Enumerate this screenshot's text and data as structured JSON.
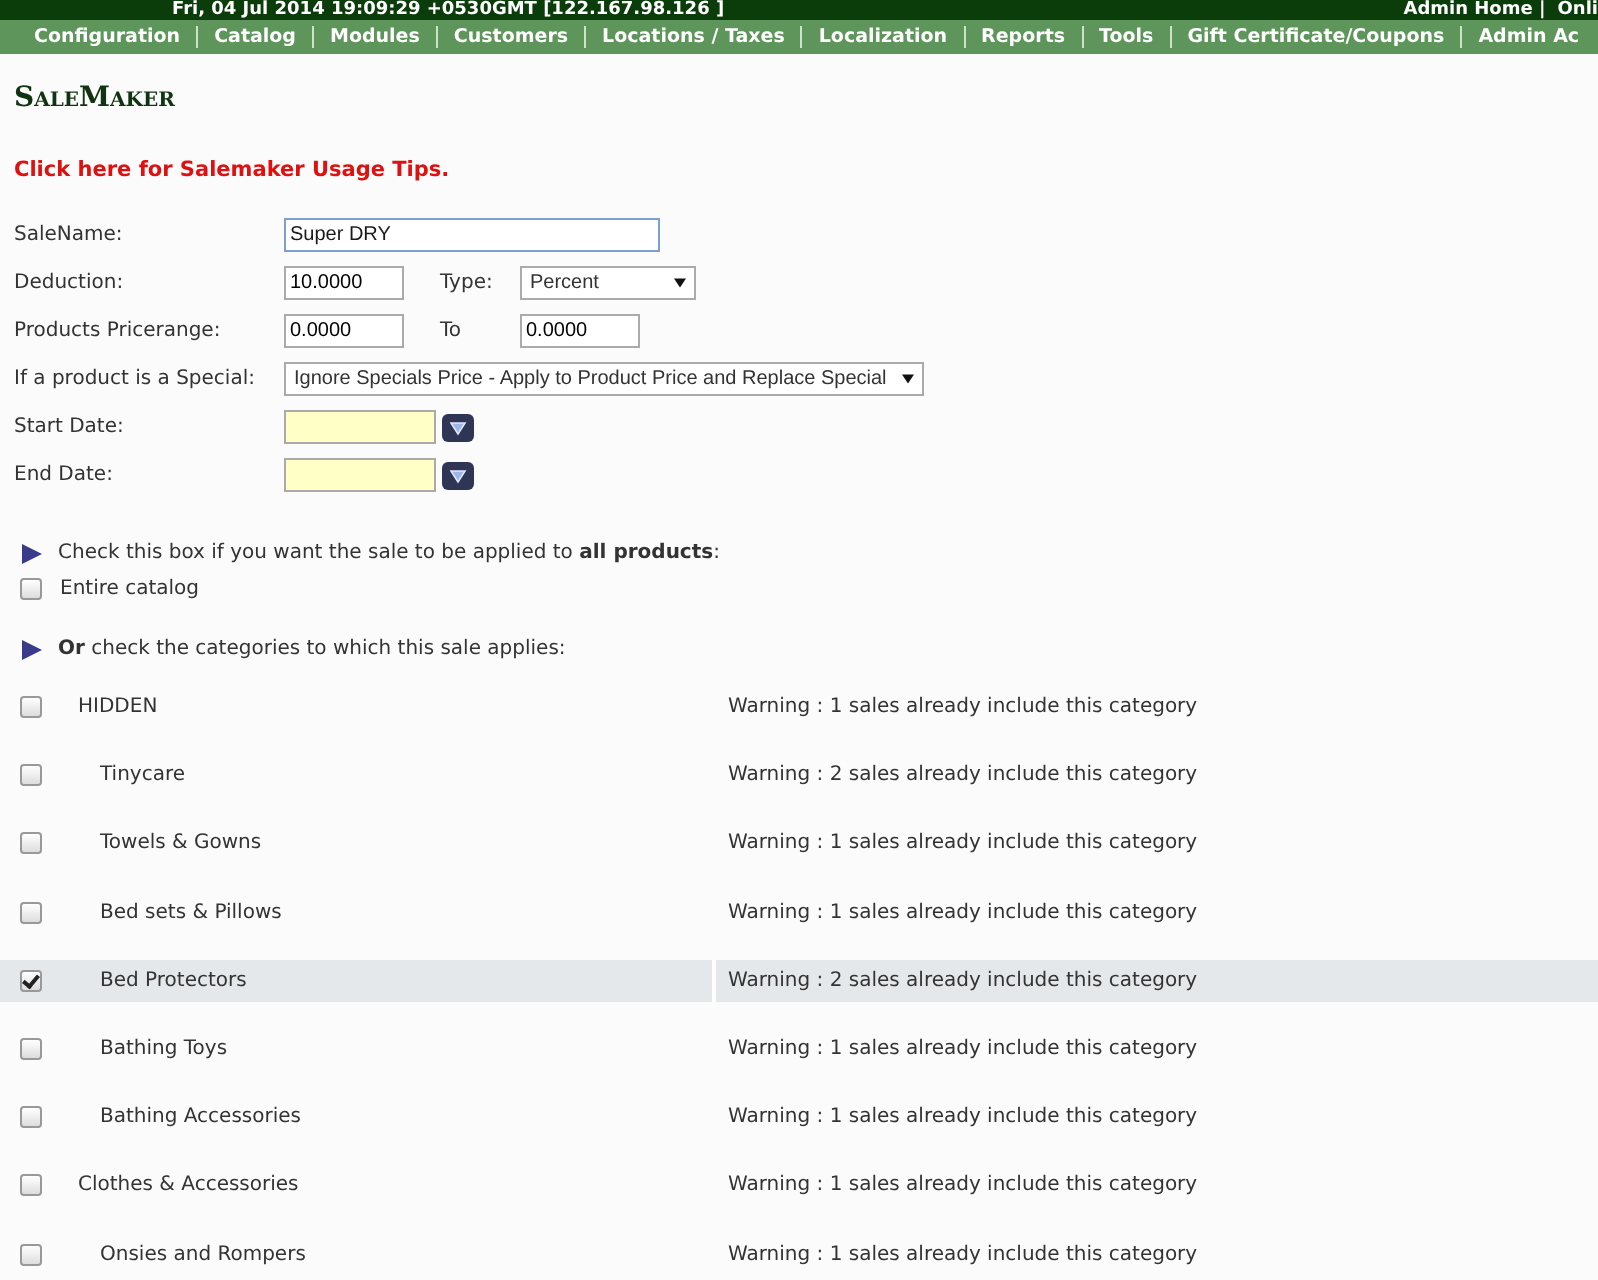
{
  "header": {
    "server_time": "Fri, 04 Jul 2014 19:09:29 +0530GMT [122.167.98.126 ]",
    "links": [
      "Admin Home |",
      "Onli"
    ]
  },
  "menu": [
    "Configuration",
    "Catalog",
    "Modules",
    "Customers",
    "Locations / Taxes",
    "Localization",
    "Reports",
    "Tools",
    "Gift Certificate/Coupons",
    "Admin Ac"
  ],
  "page_title": "SaleMaker",
  "tips_link": "Click here for Salemaker Usage Tips.",
  "form": {
    "sale_name": {
      "label": "SaleName:",
      "value": "Super DRY"
    },
    "deduction": {
      "label": "Deduction:",
      "value": "10.0000",
      "type_label": "Type:",
      "type_value": "Percent"
    },
    "price_range": {
      "label": "Products Pricerange:",
      "from": "0.0000",
      "to_label": "To",
      "to": "0.0000"
    },
    "special": {
      "label": "If a product is a Special:",
      "value": "Ignore Specials Price - Apply to Product Price and Replace Special"
    },
    "start_date": {
      "label": "Start Date:"
    },
    "end_date": {
      "label": "End Date:"
    }
  },
  "all_products": {
    "instruction": "Check this box if you want the sale to be applied to **all products**:",
    "label": "Entire catalog",
    "checked": false
  },
  "categories_instruction": "**Or** check the categories to which this sale applies:",
  "categories": [
    {
      "name": "HIDDEN",
      "checked": false,
      "warning": "Warning : 1 sales already include this category",
      "children": [
        {
          "name": "Tinycare",
          "checked": false,
          "warning": "Warning : 2 sales already include this category"
        },
        {
          "name": "Towels & Gowns",
          "checked": false,
          "warning": "Warning : 1 sales already include this category"
        },
        {
          "name": "Bed sets & Pillows",
          "checked": false,
          "warning": "Warning : 1 sales already include this category"
        },
        {
          "name": "Bed Protectors",
          "checked": true,
          "warning": "Warning : 2 sales already include this category"
        },
        {
          "name": "Bathing Toys",
          "checked": false,
          "warning": "Warning : 1 sales already include this category"
        },
        {
          "name": "Bathing Accessories",
          "checked": false,
          "warning": "Warning : 1 sales already include this category"
        }
      ]
    },
    {
      "name": "Clothes & Accessories",
      "checked": false,
      "warning": "Warning : 1 sales already include this category",
      "children": [
        {
          "name": "Onsies and Rompers",
          "checked": false,
          "warning": "Warning : 1 sales already include this category"
        }
      ]
    }
  ]
}
